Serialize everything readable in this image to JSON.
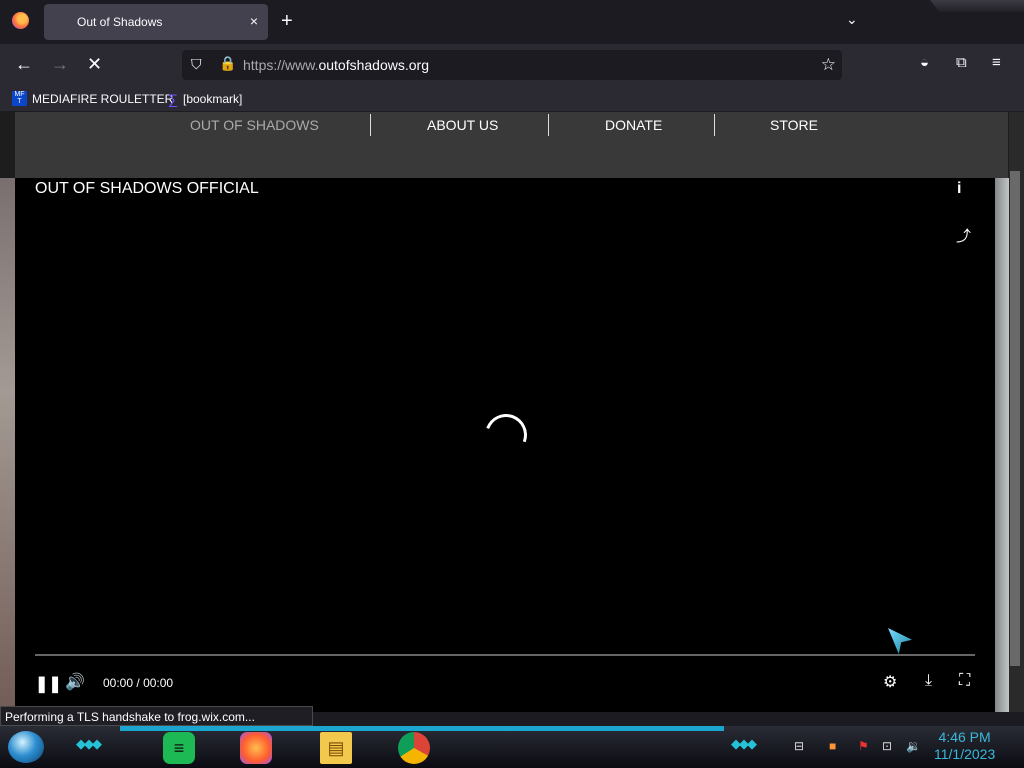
{
  "browser": {
    "tab_title": "Out of Shadows",
    "url_prefix": "https://www.",
    "url_domain": "outofshadows.org",
    "new_tab_symbol": "+",
    "tab_close_symbol": "×",
    "tab_list_symbol": "⌄"
  },
  "bookmarks": [
    {
      "label": "MEDIAFIRE ROULETTER",
      "icon_text": "MF T"
    },
    {
      "label": "[bookmark]",
      "icon": "sigma-icon"
    }
  ],
  "site": {
    "nav": [
      "OUT OF SHADOWS",
      "ABOUT US",
      "DONATE",
      "STORE"
    ]
  },
  "video": {
    "title": "OUT OF SHADOWS OFFICIAL",
    "current_time": "00:00",
    "separator": "/",
    "duration": "00:00"
  },
  "status_text": "Performing a TLS handshake to frog.wix.com...",
  "taskbar": {
    "time": "4:46 PM",
    "date": "11/1/2023"
  },
  "colors": {
    "accent": "#39b8d9",
    "browser_bg": "#2b2a33"
  }
}
